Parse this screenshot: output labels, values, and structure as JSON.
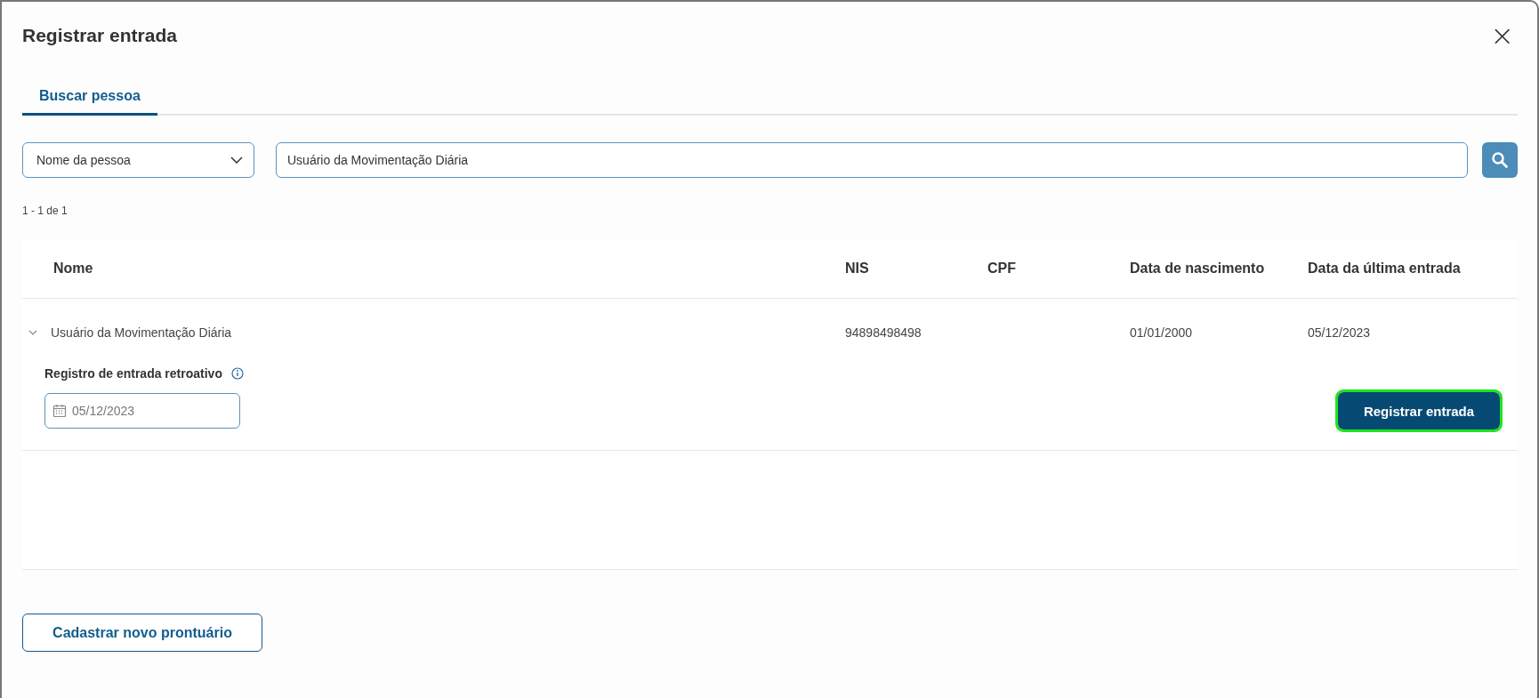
{
  "dialog": {
    "title": "Registrar entrada",
    "close": "×"
  },
  "tabs": [
    {
      "label": "Buscar pessoa",
      "selected": true
    }
  ],
  "search": {
    "filter": "Nome da pessoa",
    "value": "Usuário da Movimentação Diária"
  },
  "result_count": "1 - 1 de 1",
  "table": {
    "columns": [
      "Nome",
      "NIS",
      "CPF",
      "Data de nascimento",
      "Data da última entrada"
    ],
    "rows": [
      {
        "expanded": true,
        "cells": [
          "Usuário da Movimentação Diária",
          "94898498498",
          "",
          "01/01/2000",
          "05/12/2023"
        ],
        "detail": {
          "label": "Registro de entrada retroativo",
          "date": "05/12/2023",
          "button": {
            "label": "Registrar entrada",
            "focused": true
          }
        }
      }
    ]
  },
  "footer": {
    "button": "Cadastrar novo prontuário"
  }
}
